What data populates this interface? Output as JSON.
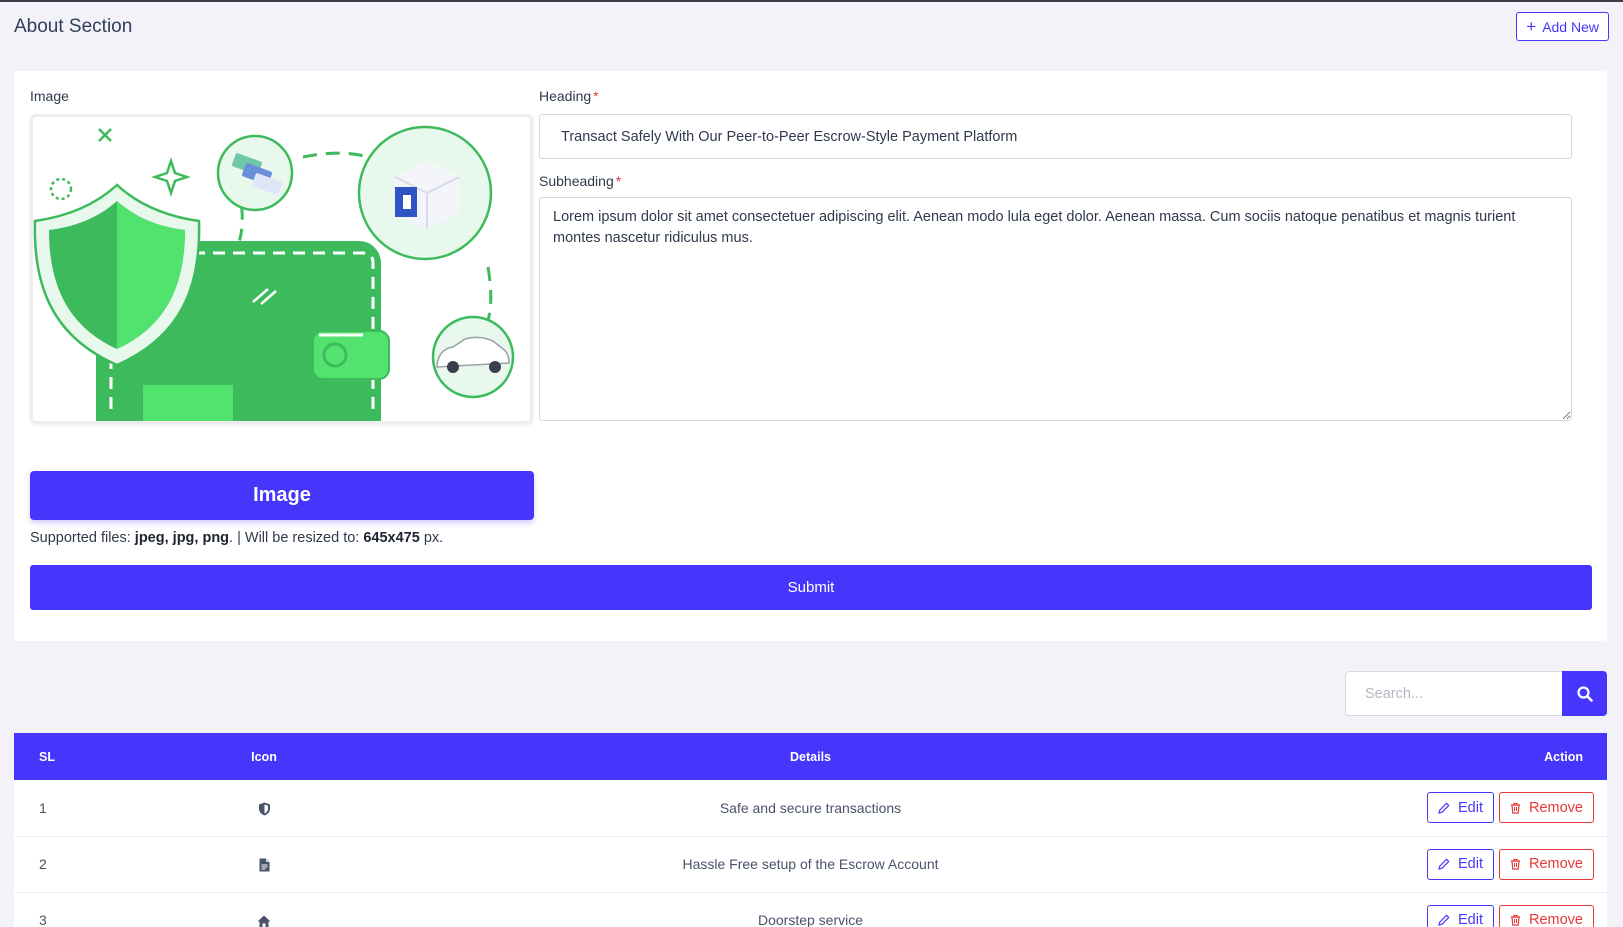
{
  "header": {
    "title": "About Section",
    "add_new_label": "Add New"
  },
  "form": {
    "image_label": "Image",
    "heading_label": "Heading",
    "heading_value": "Transact Safely With Our Peer-to-Peer Escrow-Style Payment Platform",
    "subheading_label": "Subheading",
    "subheading_value": "Lorem ipsum dolor sit amet consectetuer adipiscing elit. Aenean modo lula eget dolor. Aenean massa. Cum sociis natoque penatibus et magnis turient montes nascetur ridiculus mus.",
    "required_mark": "*",
    "upload_button_label": "Image",
    "supported_prefix": "Supported files: ",
    "supported_types": "jpeg, jpg, png",
    "supported_middle": ". | Will be resized to: ",
    "resize_dims": "645x475",
    "supported_suffix": " px.",
    "submit_label": "Submit"
  },
  "search": {
    "placeholder": "Search..."
  },
  "table": {
    "headers": {
      "sl": "SL",
      "icon": "Icon",
      "details": "Details",
      "action": "Action"
    },
    "edit_label": "Edit",
    "remove_label": "Remove",
    "rows": [
      {
        "sl": "1",
        "icon": "shield-icon",
        "details": "Safe and secure transactions"
      },
      {
        "sl": "2",
        "icon": "document-icon",
        "details": "Hassle Free setup of the Escrow Account"
      },
      {
        "sl": "3",
        "icon": "home-icon",
        "details": "Doorstep service"
      }
    ]
  },
  "colors": {
    "primary": "#4636fc",
    "danger": "#e5383b",
    "illustration_green": "#3dbb5c",
    "background": "#f2f2f8"
  }
}
